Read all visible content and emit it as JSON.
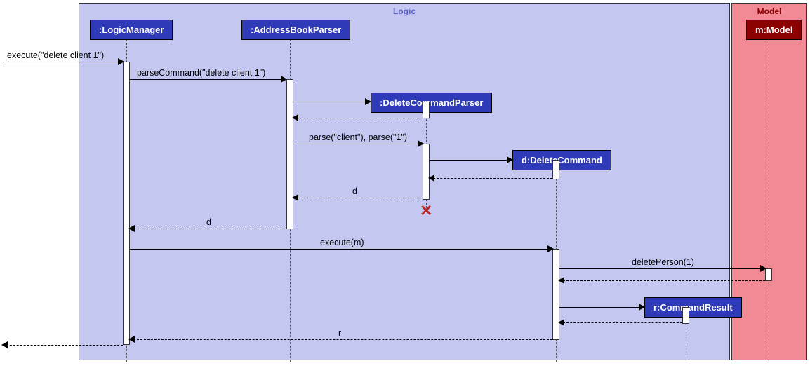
{
  "regions": {
    "logic": "Logic",
    "model": "Model"
  },
  "participants": {
    "logicManager": ":LogicManager",
    "addressBookParser": ":AddressBookParser",
    "deleteCommandParser": ":DeleteCommandParser",
    "deleteCommand": "d:DeleteCommand",
    "model": "m:Model",
    "commandResult": "r:CommandResult"
  },
  "messages": {
    "execute_delete": "execute(\"delete client 1\")",
    "parseCommand": "parseCommand(\"delete client 1\")",
    "parse_client": "parse(\"client\"), parse(\"1\")",
    "return_d1": "d",
    "return_d2": "d",
    "execute_m": "execute(m)",
    "deletePerson": "deletePerson(1)",
    "return_r": "r"
  },
  "chart_data": {
    "type": "sequence-diagram",
    "frames": [
      {
        "name": "Logic",
        "participants": [
          "LogicManager",
          "AddressBookParser",
          "DeleteCommandParser",
          "DeleteCommand",
          "CommandResult"
        ]
      },
      {
        "name": "Model",
        "participants": [
          "Model"
        ]
      }
    ],
    "participants": [
      {
        "id": "LogicManager",
        "label": ":LogicManager"
      },
      {
        "id": "AddressBookParser",
        "label": ":AddressBookParser"
      },
      {
        "id": "DeleteCommandParser",
        "label": ":DeleteCommandParser",
        "created_by": "AddressBookParser",
        "destroyed": true
      },
      {
        "id": "DeleteCommand",
        "label": "d:DeleteCommand",
        "created_by": "DeleteCommandParser"
      },
      {
        "id": "Model",
        "label": "m:Model"
      },
      {
        "id": "CommandResult",
        "label": "r:CommandResult",
        "created_by": "DeleteCommand"
      }
    ],
    "interactions": [
      {
        "from": "external",
        "to": "LogicManager",
        "message": "execute(\"delete client 1\")",
        "type": "call"
      },
      {
        "from": "LogicManager",
        "to": "AddressBookParser",
        "message": "parseCommand(\"delete client 1\")",
        "type": "call"
      },
      {
        "from": "AddressBookParser",
        "to": "DeleteCommandParser",
        "message": "",
        "type": "create"
      },
      {
        "from": "DeleteCommandParser",
        "to": "AddressBookParser",
        "message": "",
        "type": "return"
      },
      {
        "from": "AddressBookParser",
        "to": "DeleteCommandParser",
        "message": "parse(\"client\"), parse(\"1\")",
        "type": "call"
      },
      {
        "from": "DeleteCommandParser",
        "to": "DeleteCommand",
        "message": "",
        "type": "create"
      },
      {
        "from": "DeleteCommand",
        "to": "DeleteCommandParser",
        "message": "",
        "type": "return"
      },
      {
        "from": "DeleteCommandParser",
        "to": "AddressBookParser",
        "message": "d",
        "type": "return"
      },
      {
        "from": "DeleteCommandParser",
        "to": null,
        "message": "",
        "type": "destroy"
      },
      {
        "from": "AddressBookParser",
        "to": "LogicManager",
        "message": "d",
        "type": "return"
      },
      {
        "from": "LogicManager",
        "to": "DeleteCommand",
        "message": "execute(m)",
        "type": "call"
      },
      {
        "from": "DeleteCommand",
        "to": "Model",
        "message": "deletePerson(1)",
        "type": "call"
      },
      {
        "from": "Model",
        "to": "DeleteCommand",
        "message": "",
        "type": "return"
      },
      {
        "from": "DeleteCommand",
        "to": "CommandResult",
        "message": "",
        "type": "create"
      },
      {
        "from": "CommandResult",
        "to": "DeleteCommand",
        "message": "",
        "type": "return"
      },
      {
        "from": "DeleteCommand",
        "to": "LogicManager",
        "message": "r",
        "type": "return"
      },
      {
        "from": "LogicManager",
        "to": "external",
        "message": "",
        "type": "return"
      }
    ]
  }
}
